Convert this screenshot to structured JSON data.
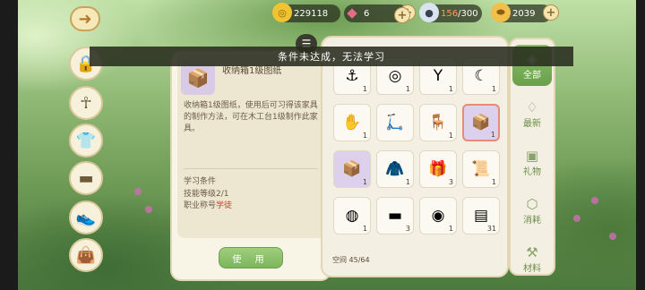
{
  "currencies": [
    {
      "name": "gold-coin",
      "value": "229118",
      "icon": "◎",
      "color": "#f1c232"
    },
    {
      "name": "gem",
      "value": "6",
      "icon": "◆",
      "color": "#e56b86"
    },
    {
      "name": "energy",
      "value": "156/300",
      "value_main": "156",
      "value_rest": "/300",
      "icon": "●",
      "color": "#d9e4f0"
    },
    {
      "name": "ticket",
      "value": "2039",
      "icon": "⬬",
      "color": "#f2c04a"
    }
  ],
  "toast": "条件未达成，无法学习",
  "detail": {
    "title": "收纳箱1级图纸",
    "description": "收纳箱1级图纸，使用后可习得该家具的制作方法，可在木工台1级制作此家具。",
    "requirements_title": "学习条件",
    "req_skill": "技能等级2/1",
    "req_title_prefix": "职业称号",
    "req_title_value": "学徒",
    "use_label": "使 用"
  },
  "inventory": {
    "space_label": "空间 45/64",
    "items": [
      {
        "name": "hook",
        "icon": "⚓",
        "count": "1"
      },
      {
        "name": "rope-coil",
        "icon": "◎",
        "count": "1"
      },
      {
        "name": "slingshot",
        "icon": "Y",
        "count": "1"
      },
      {
        "name": "sickle",
        "icon": "☾",
        "count": "1"
      },
      {
        "name": "glove",
        "icon": "✋",
        "count": "1"
      },
      {
        "name": "scooter",
        "icon": "🛴",
        "count": ""
      },
      {
        "name": "chair-blueprint",
        "icon": "🪑",
        "count": "1"
      },
      {
        "name": "box-blueprint",
        "icon": "📦",
        "count": "1"
      },
      {
        "name": "box-blueprint-2",
        "icon": "📦",
        "count": "1"
      },
      {
        "name": "jacket",
        "icon": "🧥",
        "count": "1"
      },
      {
        "name": "gift-box",
        "icon": "🎁",
        "count": "3"
      },
      {
        "name": "paper-scroll",
        "icon": "📜",
        "count": "1"
      },
      {
        "name": "cheese",
        "icon": "◍",
        "count": "1"
      },
      {
        "name": "wood-log",
        "icon": "▬",
        "count": "3"
      },
      {
        "name": "pizza",
        "icon": "◉",
        "count": "1"
      },
      {
        "name": "metal-bar",
        "icon": "▤",
        "count": "31"
      }
    ]
  },
  "categories": [
    {
      "label": "全部",
      "icon": "◈",
      "active": true
    },
    {
      "label": "最新",
      "icon": "♢",
      "active": false
    },
    {
      "label": "礼物",
      "icon": "▣",
      "active": false
    },
    {
      "label": "消耗",
      "icon": "⬡",
      "active": false
    },
    {
      "label": "材料",
      "icon": "⚒",
      "active": false
    }
  ],
  "side_icons": [
    "lock-icon",
    "pharaoh-icon",
    "shirt-icon",
    "shorts-icon",
    "shoes-icon",
    "bag-icon"
  ],
  "colors": {
    "accent": "#7cb55d",
    "warning": "#d23a2a",
    "selected": "#e98a74"
  }
}
